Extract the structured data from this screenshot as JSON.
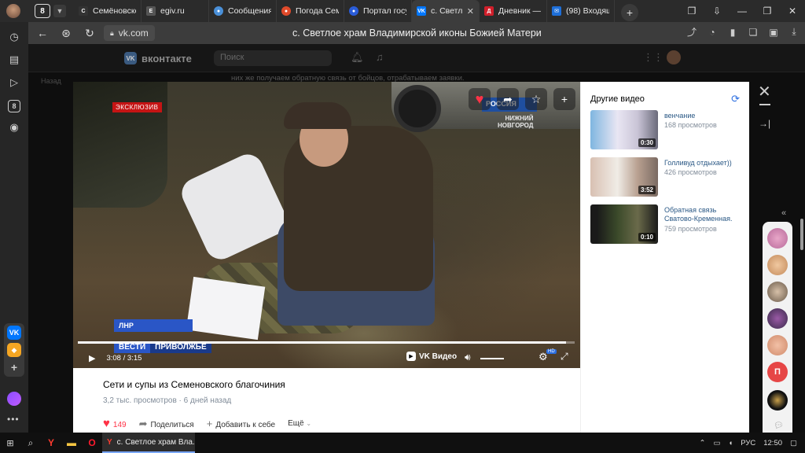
{
  "browser": {
    "tab_count": "8",
    "tabs": [
      {
        "title": "Семёновско",
        "fav": "С",
        "fav_color": "#333333"
      },
      {
        "title": "egiv.ru",
        "fav": "E",
        "fav_color": "#555555"
      },
      {
        "title": "Сообщения",
        "fav": "●",
        "fav_color": "#4a90d9"
      },
      {
        "title": "Погода Сем",
        "fav": "●",
        "fav_color": "#e04a2a"
      },
      {
        "title": "Портал госу",
        "fav": "●",
        "fav_color": "#2a5cd8"
      },
      {
        "title": "с. Светло",
        "fav": "VK",
        "fav_color": "#0077ff",
        "active": true
      },
      {
        "title": "Дневник —",
        "fav": "Д",
        "fav_color": "#d01e2a"
      },
      {
        "title": "(98) Входящ",
        "fav": "✉",
        "fav_color": "#1e6fd9"
      }
    ],
    "url": "vk.com",
    "page_title": "с. Светлое храм Владимирской иконы Божией Матери"
  },
  "vk": {
    "logo_text": "вконтакте",
    "search_placeholder": "Поиск",
    "bg_post_text": "них же получаем обратную связь от бойцов, отрабатываем заявки.",
    "bg_back": "Назад"
  },
  "video": {
    "badge_exclusive": "ЭКСКЛЮЗИВ",
    "channel_logo": "РОССИЯ",
    "channel_region": "НИЖНИЙ\nНОВГОРОД",
    "chyron_location": "ЛНР",
    "chyron_vesti": "ВЕСТИ",
    "chyron_region": "ПРИВОЛЖЬЕ",
    "current_time": "3:08",
    "duration": "3:15",
    "progress": 0.982,
    "player_brand": "VK Видео",
    "quality_badge": "HD",
    "title": "Сети и супы из Семеновского благочиния",
    "views": "3,2 тыс. просмотров",
    "date": "6 дней назад",
    "likes": "149",
    "share_label": "Поделиться",
    "add_label": "Добавить к себе",
    "more_label": "Ещё"
  },
  "related": {
    "heading": "Другие видео",
    "items": [
      {
        "title": "венчание",
        "views": "168 просмотров",
        "duration": "0:30"
      },
      {
        "title": "Голливуд отдыхает))",
        "views": "426 просмотров",
        "duration": "3:52"
      },
      {
        "title": "Обратная связь Сватово-Кременная.",
        "views": "759 просмотров",
        "duration": "0:10"
      }
    ]
  },
  "chats": {
    "letter_avatar": "П"
  },
  "taskbar": {
    "active_app": "с. Светлое храм Вла...",
    "lang": "РУС",
    "time": "12:50"
  }
}
